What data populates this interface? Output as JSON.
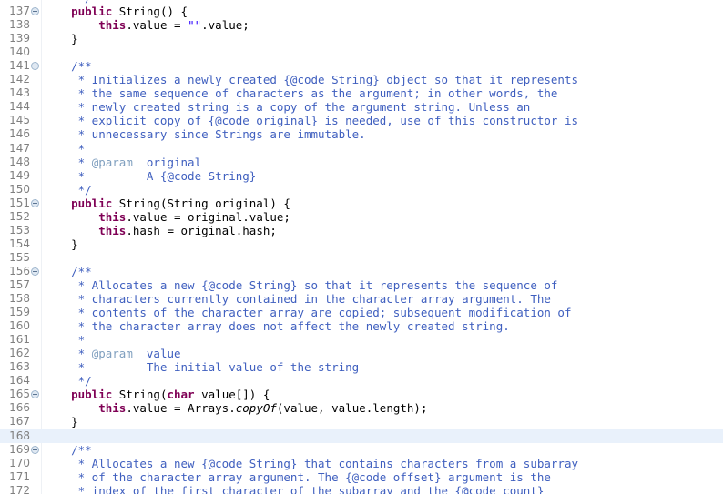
{
  "editor": {
    "name": "java-source-editor",
    "language": "Java",
    "file_context": "String.java",
    "current_line": 168,
    "colors": {
      "background": "#ffffff",
      "line_number": "#808080",
      "current_line_highlight": "#e9f1fb",
      "keyword": "#7f0055",
      "string": "#2a00ff",
      "javadoc": "#3f5fbf",
      "javadoc_tag": "#7f9fbf",
      "plain_text": "#000000",
      "fold_marker": "#9fb6cd"
    },
    "first_visible_line": 137,
    "last_visible_line": 172
  },
  "lines": [
    {
      "num": 137,
      "fold": true,
      "highlight": false,
      "tokens": [
        {
          "t": "    ",
          "c": "plain"
        },
        {
          "t": "public",
          "c": "kw"
        },
        {
          "t": " String() {",
          "c": "plain"
        }
      ]
    },
    {
      "num": 138,
      "fold": false,
      "highlight": false,
      "tokens": [
        {
          "t": "        ",
          "c": "plain"
        },
        {
          "t": "this",
          "c": "kw"
        },
        {
          "t": ".value = ",
          "c": "plain"
        },
        {
          "t": "\"\"",
          "c": "str"
        },
        {
          "t": ".value;",
          "c": "plain"
        }
      ]
    },
    {
      "num": 139,
      "fold": false,
      "highlight": false,
      "tokens": [
        {
          "t": "    }",
          "c": "plain"
        }
      ]
    },
    {
      "num": 140,
      "fold": false,
      "highlight": false,
      "tokens": [
        {
          "t": "",
          "c": "plain"
        }
      ]
    },
    {
      "num": 141,
      "fold": true,
      "highlight": false,
      "tokens": [
        {
          "t": "    ",
          "c": "plain"
        },
        {
          "t": "/**",
          "c": "jdoc"
        }
      ]
    },
    {
      "num": 142,
      "fold": false,
      "highlight": false,
      "tokens": [
        {
          "t": "     * Initializes a newly created {@code String} object so that it represents",
          "c": "jdoc"
        }
      ]
    },
    {
      "num": 143,
      "fold": false,
      "highlight": false,
      "tokens": [
        {
          "t": "     * the same sequence of characters as the argument; in other words, the",
          "c": "jdoc"
        }
      ]
    },
    {
      "num": 144,
      "fold": false,
      "highlight": false,
      "tokens": [
        {
          "t": "     * newly created string is a copy of the argument string. Unless an",
          "c": "jdoc"
        }
      ]
    },
    {
      "num": 145,
      "fold": false,
      "highlight": false,
      "tokens": [
        {
          "t": "     * explicit copy of {@code original} is needed, use of this constructor is",
          "c": "jdoc"
        }
      ]
    },
    {
      "num": 146,
      "fold": false,
      "highlight": false,
      "tokens": [
        {
          "t": "     * unnecessary since Strings are immutable.",
          "c": "jdoc"
        }
      ]
    },
    {
      "num": 147,
      "fold": false,
      "highlight": false,
      "tokens": [
        {
          "t": "     *",
          "c": "jdoc"
        }
      ]
    },
    {
      "num": 148,
      "fold": false,
      "highlight": false,
      "tokens": [
        {
          "t": "     * ",
          "c": "jdoc"
        },
        {
          "t": "@param",
          "c": "jtag"
        },
        {
          "t": "  original",
          "c": "jdoc"
        }
      ]
    },
    {
      "num": 149,
      "fold": false,
      "highlight": false,
      "tokens": [
        {
          "t": "     *         A {@code String}",
          "c": "jdoc"
        }
      ]
    },
    {
      "num": 150,
      "fold": false,
      "highlight": false,
      "tokens": [
        {
          "t": "     */",
          "c": "jdoc"
        }
      ]
    },
    {
      "num": 151,
      "fold": true,
      "highlight": false,
      "tokens": [
        {
          "t": "    ",
          "c": "plain"
        },
        {
          "t": "public",
          "c": "kw"
        },
        {
          "t": " String(String original) {",
          "c": "plain"
        }
      ]
    },
    {
      "num": 152,
      "fold": false,
      "highlight": false,
      "tokens": [
        {
          "t": "        ",
          "c": "plain"
        },
        {
          "t": "this",
          "c": "kw"
        },
        {
          "t": ".value = original.value;",
          "c": "plain"
        }
      ]
    },
    {
      "num": 153,
      "fold": false,
      "highlight": false,
      "tokens": [
        {
          "t": "        ",
          "c": "plain"
        },
        {
          "t": "this",
          "c": "kw"
        },
        {
          "t": ".hash = original.hash;",
          "c": "plain"
        }
      ]
    },
    {
      "num": 154,
      "fold": false,
      "highlight": false,
      "tokens": [
        {
          "t": "    }",
          "c": "plain"
        }
      ]
    },
    {
      "num": 155,
      "fold": false,
      "highlight": false,
      "tokens": [
        {
          "t": "",
          "c": "plain"
        }
      ]
    },
    {
      "num": 156,
      "fold": true,
      "highlight": false,
      "tokens": [
        {
          "t": "    ",
          "c": "plain"
        },
        {
          "t": "/**",
          "c": "jdoc"
        }
      ]
    },
    {
      "num": 157,
      "fold": false,
      "highlight": false,
      "tokens": [
        {
          "t": "     * Allocates a new {@code String} so that it represents the sequence of",
          "c": "jdoc"
        }
      ]
    },
    {
      "num": 158,
      "fold": false,
      "highlight": false,
      "tokens": [
        {
          "t": "     * characters currently contained in the character array argument. The",
          "c": "jdoc"
        }
      ]
    },
    {
      "num": 159,
      "fold": false,
      "highlight": false,
      "tokens": [
        {
          "t": "     * contents of the character array are copied; subsequent modification of",
          "c": "jdoc"
        }
      ]
    },
    {
      "num": 160,
      "fold": false,
      "highlight": false,
      "tokens": [
        {
          "t": "     * the character array does not affect the newly created string.",
          "c": "jdoc"
        }
      ]
    },
    {
      "num": 161,
      "fold": false,
      "highlight": false,
      "tokens": [
        {
          "t": "     *",
          "c": "jdoc"
        }
      ]
    },
    {
      "num": 162,
      "fold": false,
      "highlight": false,
      "tokens": [
        {
          "t": "     * ",
          "c": "jdoc"
        },
        {
          "t": "@param",
          "c": "jtag"
        },
        {
          "t": "  value",
          "c": "jdoc"
        }
      ]
    },
    {
      "num": 163,
      "fold": false,
      "highlight": false,
      "tokens": [
        {
          "t": "     *         The initial value of the string",
          "c": "jdoc"
        }
      ]
    },
    {
      "num": 164,
      "fold": false,
      "highlight": false,
      "tokens": [
        {
          "t": "     */",
          "c": "jdoc"
        }
      ]
    },
    {
      "num": 165,
      "fold": true,
      "highlight": false,
      "tokens": [
        {
          "t": "    ",
          "c": "plain"
        },
        {
          "t": "public",
          "c": "kw"
        },
        {
          "t": " String(",
          "c": "plain"
        },
        {
          "t": "char",
          "c": "kw"
        },
        {
          "t": " value[]) {",
          "c": "plain"
        }
      ]
    },
    {
      "num": 166,
      "fold": false,
      "highlight": false,
      "tokens": [
        {
          "t": "        ",
          "c": "plain"
        },
        {
          "t": "this",
          "c": "kw"
        },
        {
          "t": ".value = Arrays.",
          "c": "plain"
        },
        {
          "t": "copyOf",
          "c": "static"
        },
        {
          "t": "(value, value.length);",
          "c": "plain"
        }
      ]
    },
    {
      "num": 167,
      "fold": false,
      "highlight": false,
      "tokens": [
        {
          "t": "    }",
          "c": "plain"
        }
      ]
    },
    {
      "num": 168,
      "fold": false,
      "highlight": true,
      "tokens": [
        {
          "t": "",
          "c": "plain"
        }
      ]
    },
    {
      "num": 169,
      "fold": true,
      "highlight": false,
      "tokens": [
        {
          "t": "    ",
          "c": "plain"
        },
        {
          "t": "/**",
          "c": "jdoc"
        }
      ]
    },
    {
      "num": 170,
      "fold": false,
      "highlight": false,
      "tokens": [
        {
          "t": "     * Allocates a new {@code String} that contains characters from a subarray",
          "c": "jdoc"
        }
      ]
    },
    {
      "num": 171,
      "fold": false,
      "highlight": false,
      "tokens": [
        {
          "t": "     * of the character array argument. The {@code offset} argument is the",
          "c": "jdoc"
        }
      ]
    },
    {
      "num": 172,
      "fold": false,
      "highlight": false,
      "tokens": [
        {
          "t": "     * index of the first character of the subarray and the {@code count}",
          "c": "jdoc"
        }
      ]
    }
  ],
  "clipped_top_line": {
    "tokens": [
      {
        "t": "     */",
        "c": "jdoc"
      }
    ]
  }
}
